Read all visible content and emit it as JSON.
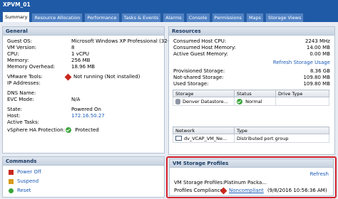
{
  "window": {
    "title": "XPVM_01"
  },
  "tabs": [
    {
      "label": "Summary",
      "active": true
    },
    {
      "label": "Resource Allocation"
    },
    {
      "label": "Performance"
    },
    {
      "label": "Tasks & Events"
    },
    {
      "label": "Alarms"
    },
    {
      "label": "Console"
    },
    {
      "label": "Permissions"
    },
    {
      "label": "Maps"
    },
    {
      "label": "Storage Views"
    }
  ],
  "general": {
    "title": "General",
    "rows": [
      {
        "label": "Guest OS:",
        "value": "Microsoft Windows XP Professional (32-b..."
      },
      {
        "label": "VM Version:",
        "value": "8"
      },
      {
        "label": "CPU:",
        "value": "1 vCPU"
      },
      {
        "label": "Memory:",
        "value": "256 MB"
      },
      {
        "label": "Memory Overhead:",
        "value": "18.96 MB"
      },
      {
        "label": "VMware Tools:",
        "value": "Not running (Not installed)"
      },
      {
        "label": "IP Addresses:",
        "value": ""
      },
      {
        "label": "DNS Name:",
        "value": ""
      },
      {
        "label": "EVC Mode:",
        "value": "N/A"
      },
      {
        "label": "State:",
        "value": "Powered On"
      },
      {
        "label": "Host:",
        "value": "172.16.50.27"
      },
      {
        "label": "Active Tasks:",
        "value": ""
      },
      {
        "label": "vSphere HA Protection:",
        "value": "Protected"
      }
    ]
  },
  "commands": {
    "title": "Commands",
    "items": [
      {
        "label": "Power Off"
      },
      {
        "label": "Suspend"
      },
      {
        "label": "Reset"
      }
    ]
  },
  "resources": {
    "title": "Resources",
    "rows": [
      {
        "label": "Consumed Host CPU:",
        "value": "2243 MHz"
      },
      {
        "label": "Consumed Host Memory:",
        "value": "14.00 MB"
      },
      {
        "label": "Active Guest Memory:",
        "value": "0.00 MB"
      }
    ],
    "refresh_link": "Refresh Storage Usage",
    "storage_rows": [
      {
        "label": "Provisioned Storage:",
        "value": "8.36 GB"
      },
      {
        "label": "Not-shared Storage:",
        "value": "109.80 MB"
      },
      {
        "label": "Used Storage:",
        "value": "109.80 MB"
      }
    ],
    "storage_table": {
      "headers": [
        "Storage",
        "Status",
        "Drive Type"
      ],
      "rows": [
        {
          "storage": "Denver Datastore...",
          "status": "Normal",
          "drive_type": ""
        }
      ]
    },
    "network_table": {
      "headers": [
        "Network",
        "Type"
      ],
      "rows": [
        {
          "network": "dv_VCAP_VM_Ne...",
          "type": "Distributed port group"
        }
      ]
    }
  },
  "profiles": {
    "title": "VM Storage Profiles",
    "refresh": "Refresh",
    "profiles_label": "VM Storage Profiles:",
    "profiles_value": "Platinum Packa...",
    "compliance_label": "Profiles Compliance:",
    "compliance_status": "Noncompliant",
    "compliance_time": "(9/8/2016 10:56:36 AM)"
  },
  "colors": {
    "accent": "#1f5aa6",
    "highlight": "#d4202a",
    "link": "#1b5bb8"
  }
}
